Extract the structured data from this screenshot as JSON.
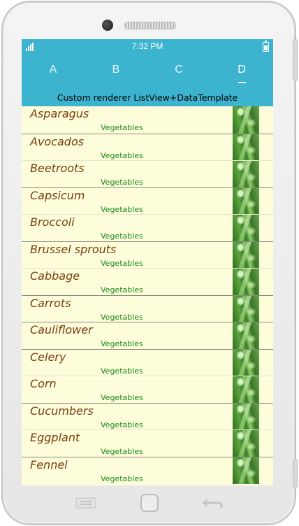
{
  "status_bar": {
    "time": "7:32 PM"
  },
  "tabs": [
    {
      "label": "A",
      "active": false
    },
    {
      "label": "B",
      "active": false
    },
    {
      "label": "C",
      "active": false
    },
    {
      "label": "D",
      "active": true
    }
  ],
  "header": {
    "title": "Custom renderer ListView+DataTemplate"
  },
  "items": [
    {
      "name": "Asparagus",
      "category": "Vegetables"
    },
    {
      "name": "Avocados",
      "category": "Vegetables"
    },
    {
      "name": "Beetroots",
      "category": "Vegetables"
    },
    {
      "name": "Capsicum",
      "category": "Vegetables"
    },
    {
      "name": "Broccoli",
      "category": "Vegetables"
    },
    {
      "name": "Brussel sprouts",
      "category": "Vegetables"
    },
    {
      "name": "Cabbage",
      "category": "Vegetables"
    },
    {
      "name": "Carrots",
      "category": "Vegetables"
    },
    {
      "name": "Cauliflower",
      "category": "Vegetables"
    },
    {
      "name": "Celery",
      "category": "Vegetables"
    },
    {
      "name": "Corn",
      "category": "Vegetables"
    },
    {
      "name": "Cucumbers",
      "category": "Vegetables"
    },
    {
      "name": "Eggplant",
      "category": "Vegetables"
    },
    {
      "name": "Fennel",
      "category": "Vegetables"
    }
  ],
  "icons": {
    "signal": "signal-icon",
    "battery": "battery-icon",
    "thumbnail": "vegetable-thumbnail-icon",
    "menu": "menu-icon",
    "home": "home-icon",
    "back": "back-icon"
  },
  "colors": {
    "accent": "#3db4cf",
    "list_background": "#fdfddc",
    "item_name": "#7a3c0a",
    "item_category": "#1a8a1a"
  }
}
